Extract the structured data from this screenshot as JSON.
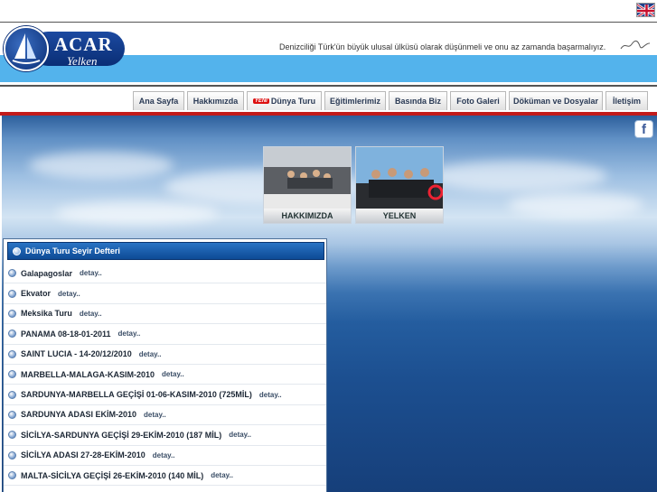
{
  "language": {
    "flag_icon": "uk-flag-icon"
  },
  "brand": {
    "name": "ACAR",
    "subtitle": "Yelken"
  },
  "header": {
    "slogan": "Denizciliği Türk'ün büyük ulusal ülküsü olarak düşünmeli ve onu az zamanda başarmalıyız."
  },
  "nav": {
    "items": [
      {
        "label": "Ana Sayfa"
      },
      {
        "label": "Hakkımızda"
      },
      {
        "label": "Dünya Turu",
        "badge": "YENİ"
      },
      {
        "label": "Eğitimlerimiz"
      },
      {
        "label": "Basında Biz"
      },
      {
        "label": "Foto Galeri"
      },
      {
        "label": "Döküman ve Dosyalar"
      },
      {
        "label": "İletişim"
      }
    ]
  },
  "social": {
    "facebook_label": "f"
  },
  "thumbs": [
    {
      "caption": "HAKKIMIZDA"
    },
    {
      "caption": "YELKEN"
    }
  ],
  "logbook": {
    "title": "Dünya Turu Seyir Defteri",
    "detail_label": "detay..",
    "entries": [
      {
        "title": "Galapagoslar"
      },
      {
        "title": "Ekvator"
      },
      {
        "title": "Meksika Turu"
      },
      {
        "title": "PANAMA 08-18-01-2011"
      },
      {
        "title": "SAINT LUCIA - 14-20/12/2010"
      },
      {
        "title": "MARBELLA-MALAGA-KASIM-2010"
      },
      {
        "title": "SARDUNYA-MARBELLA GEÇİŞİ 01-06-KASIM-2010 (725MİL)"
      },
      {
        "title": "SARDUNYA ADASI EKİM-2010"
      },
      {
        "title": "SİCİLYA-SARDUNYA GEÇİŞİ 29-EKİM-2010 (187 MİL)"
      },
      {
        "title": "SİCİLYA ADASI 27-28-EKİM-2010"
      },
      {
        "title": "MALTA-SİCİLYA GEÇİŞİ 26-EKİM-2010 (140 MİL)"
      }
    ]
  },
  "colors": {
    "header_band": "#53b3ec",
    "brand_navy": "#0a2e75",
    "nav_rule": "#c21b1b",
    "panel_header": "#1a5eaf"
  }
}
